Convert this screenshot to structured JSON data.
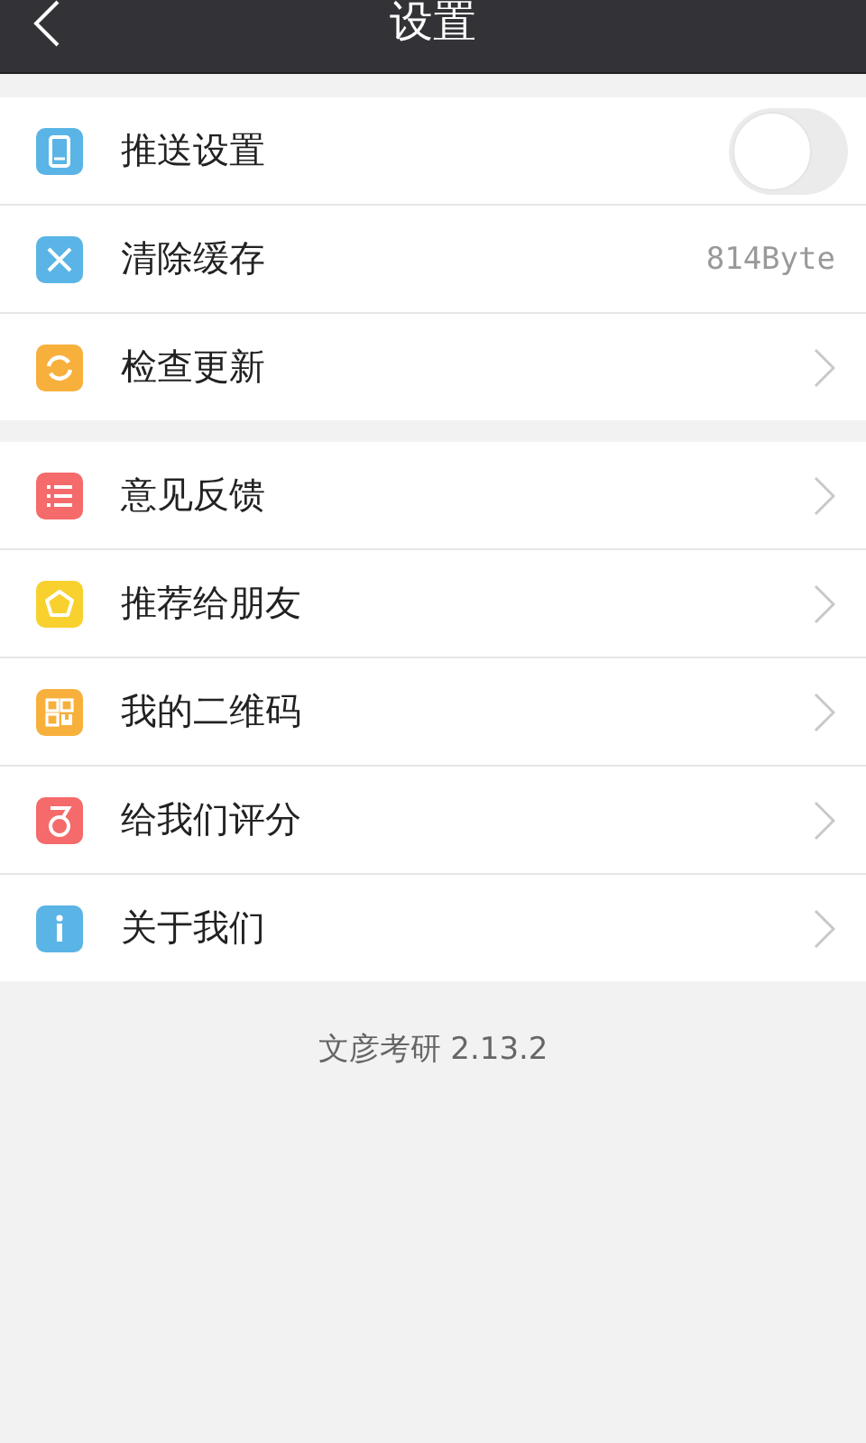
{
  "header": {
    "title": "设置"
  },
  "sections": [
    {
      "items": [
        {
          "label": "推送设置",
          "kind": "toggle",
          "on": false,
          "color": "#5ab4e6"
        },
        {
          "label": "清除缓存",
          "kind": "value",
          "value": "814Byte",
          "color": "#5ab4e6"
        },
        {
          "label": "检查更新",
          "kind": "arrow",
          "color": "#f7b03c"
        }
      ]
    },
    {
      "items": [
        {
          "label": "意见反馈",
          "kind": "arrow",
          "color": "#f56a6a"
        },
        {
          "label": "推荐给朋友",
          "kind": "arrow",
          "color": "#f8d12e"
        },
        {
          "label": "我的二维码",
          "kind": "arrow",
          "color": "#f7b03c"
        },
        {
          "label": "给我们评分",
          "kind": "arrow",
          "color": "#f56a6a"
        },
        {
          "label": "关于我们",
          "kind": "arrow",
          "color": "#5ab4e6"
        }
      ]
    }
  ],
  "footer": {
    "version": "文彦考研 2.13.2"
  }
}
